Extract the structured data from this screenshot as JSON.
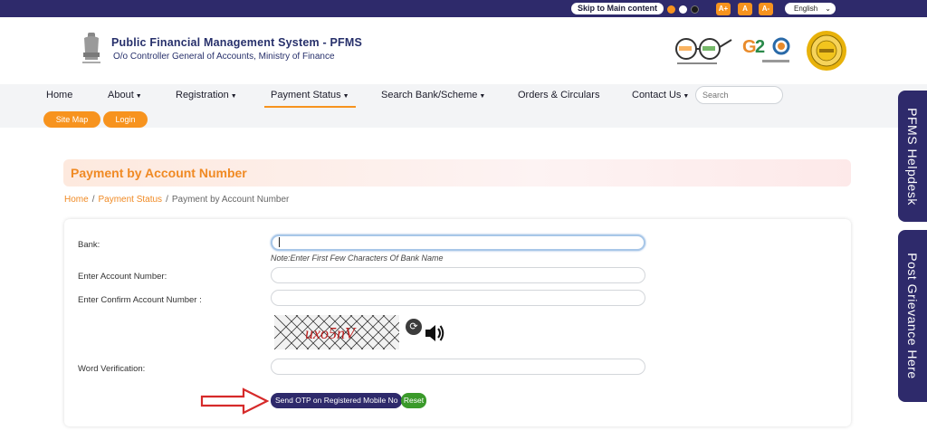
{
  "topbar": {
    "skip_label": "Skip to Main content",
    "font_increase": "A+",
    "font_normal": "A",
    "font_decrease": "A-",
    "language": "English"
  },
  "header": {
    "title": "Public Financial Management System - PFMS",
    "subtitle": "O/o Controller General of Accounts, Ministry of Finance"
  },
  "nav": {
    "items": [
      {
        "label": "Home"
      },
      {
        "label": "About"
      },
      {
        "label": "Registration"
      },
      {
        "label": "Payment Status"
      },
      {
        "label": "Search Bank/Scheme"
      },
      {
        "label": "Orders & Circulars"
      },
      {
        "label": "Contact Us"
      }
    ],
    "search_placeholder": "Search",
    "site_map": "Site Map",
    "login": "Login"
  },
  "side_tabs": {
    "helpdesk": "PFMS Helpdesk",
    "grievance": "Post Grievance Here"
  },
  "page": {
    "heading": "Payment by Account Number",
    "breadcrumb": [
      "Home",
      "Payment Status",
      "Payment by Account Number"
    ]
  },
  "form": {
    "bank_label": "Bank:",
    "bank_note": "Note:Enter First Few Characters Of Bank Name",
    "account_label": "Enter Account Number:",
    "confirm_label": "Enter Confirm Account Number :",
    "captcha_text": "uxo5nV",
    "word_label": "Word Verification:",
    "send_otp": "Send OTP on Registered Mobile No",
    "reset": "Reset"
  },
  "colors": {
    "brand_navy": "#2e2a6b",
    "accent_orange": "#f7931e",
    "reset_green": "#3a9a2a",
    "annotation_red": "#d62a2a"
  }
}
